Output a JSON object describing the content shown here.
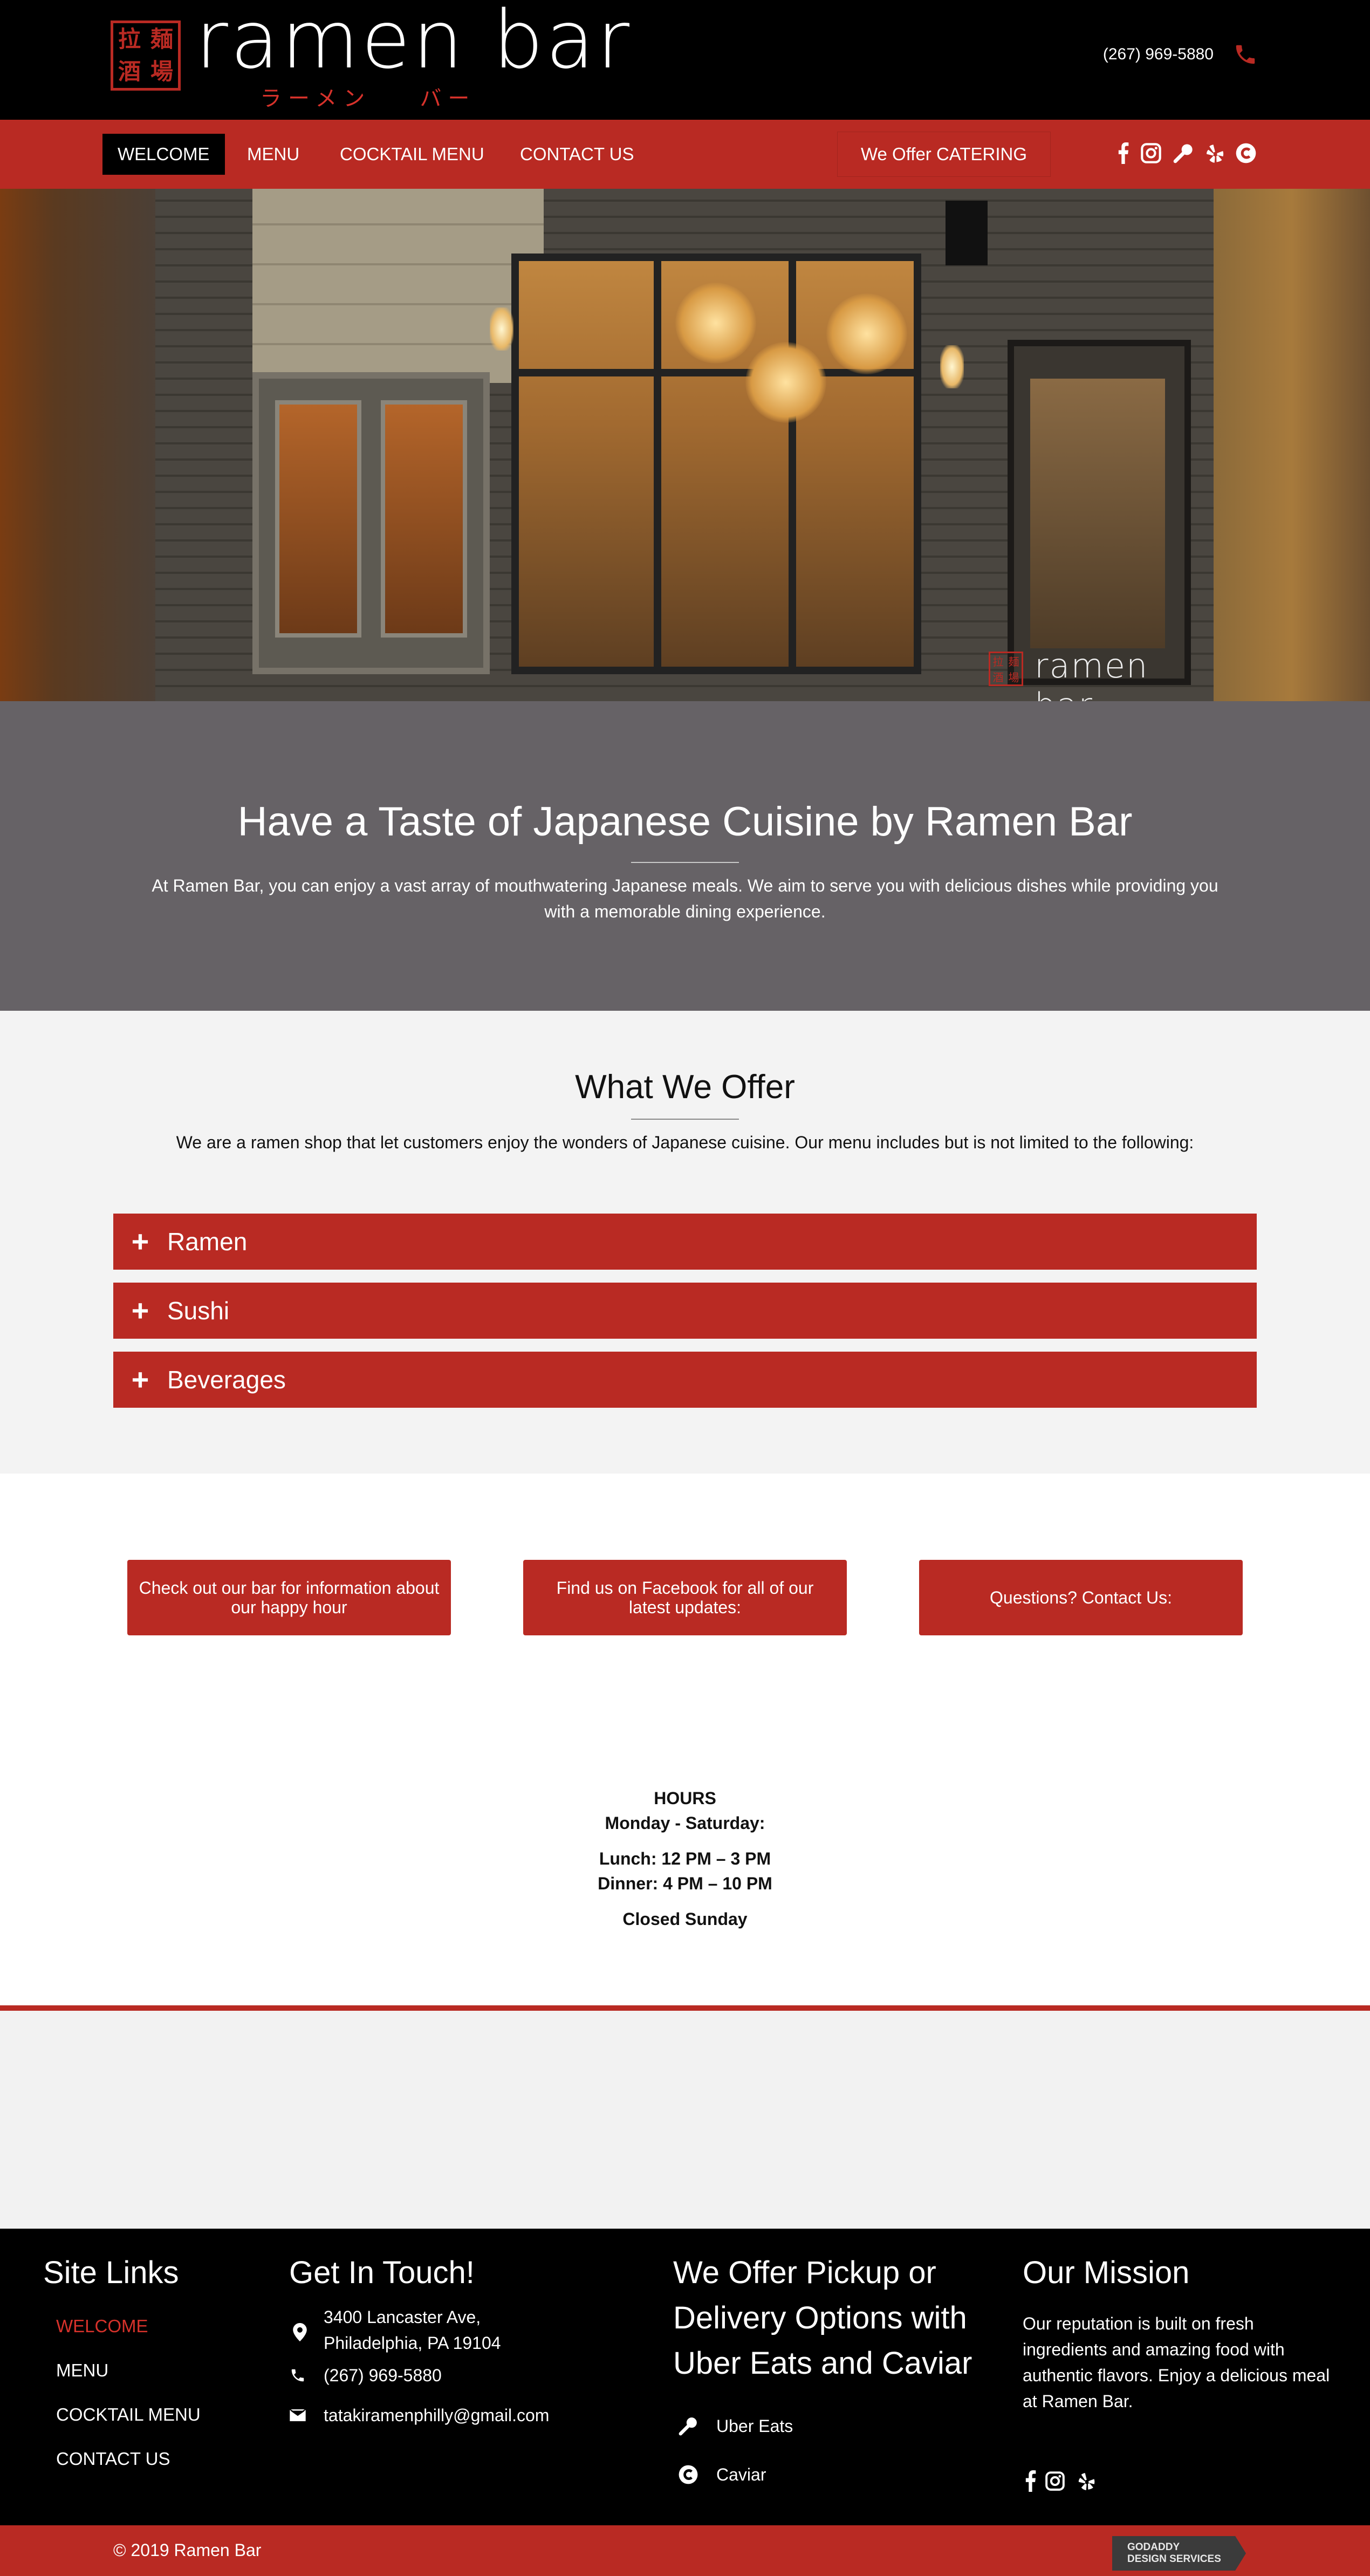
{
  "header": {
    "logo_chars": [
      "拉",
      "麺",
      "酒",
      "場"
    ],
    "brand_name": "ramen bar",
    "brand_sub_left": "ラーメン",
    "brand_sub_right": "バー",
    "phone": "(267) 969-5880",
    "accent_color": "#b92a23"
  },
  "nav": {
    "items": [
      {
        "label": "WELCOME",
        "active": true
      },
      {
        "label": "MENU",
        "active": false
      },
      {
        "label": "COCKTAIL MENU",
        "active": false
      },
      {
        "label": "CONTACT US",
        "active": false
      }
    ],
    "catering_label": "We Offer CATERING",
    "social_icons": [
      "facebook-icon",
      "instagram-icon",
      "ubereats-icon",
      "yelp-icon",
      "caviar-icon"
    ]
  },
  "hero": {
    "watermark_chars": [
      "拉",
      "麺",
      "酒",
      "場"
    ],
    "watermark_text": "ramen bar"
  },
  "taste": {
    "title": "Have a Taste of Japanese Cuisine by Ramen Bar",
    "body": "At Ramen Bar, you can enjoy a vast array of mouthwatering Japanese meals. We aim to serve you with delicious dishes while providing you with a memorable dining experience."
  },
  "offer": {
    "title": "What We Offer",
    "intro": "We are a ramen shop that let customers enjoy the wonders of Japanese cuisine. Our menu includes but is not limited to the following:",
    "accordion": [
      {
        "icon": "+",
        "label": "Ramen"
      },
      {
        "icon": "+",
        "label": "Sushi"
      },
      {
        "icon": "+",
        "label": "Beverages"
      }
    ]
  },
  "cta": {
    "buttons": [
      "Check out our bar for information about our happy hour",
      "Find us on Facebook for all of our latest updates:",
      "Questions? Contact Us:"
    ]
  },
  "hours": {
    "heading": "HOURS",
    "days": "Monday - Saturday:",
    "lunch": "Lunch: 12 PM – 3 PM",
    "dinner": "Dinner: 4 PM – 10 PM",
    "closed": "Closed Sunday"
  },
  "footer": {
    "site_links": {
      "title": "Site Links",
      "items": [
        "WELCOME",
        "MENU",
        "COCKTAIL MENU",
        "CONTACT US"
      ]
    },
    "contact": {
      "title": "Get In Touch!",
      "address_line1": "3400 Lancaster Ave,",
      "address_line2": "Philadelphia, PA 19104",
      "phone": "(267) 969-5880",
      "email": "tatakiramenphilly@gmail.com"
    },
    "delivery": {
      "title_lines": [
        "We Offer Pickup or",
        "Delivery Options with",
        "Uber Eats and Caviar"
      ],
      "items": [
        "Uber Eats",
        "Caviar"
      ]
    },
    "mission": {
      "title": "Our Mission",
      "body": "Our reputation is built on fresh ingredients and amazing food with authentic flavors. Enjoy a delicious meal at Ramen Bar.",
      "social_icons": [
        "facebook-icon",
        "instagram-icon",
        "yelp-icon"
      ]
    }
  },
  "bottom": {
    "copyright": "© 2019 Ramen Bar",
    "badge_line1": "GODADDY",
    "badge_line2": "DESIGN SERVICES"
  }
}
